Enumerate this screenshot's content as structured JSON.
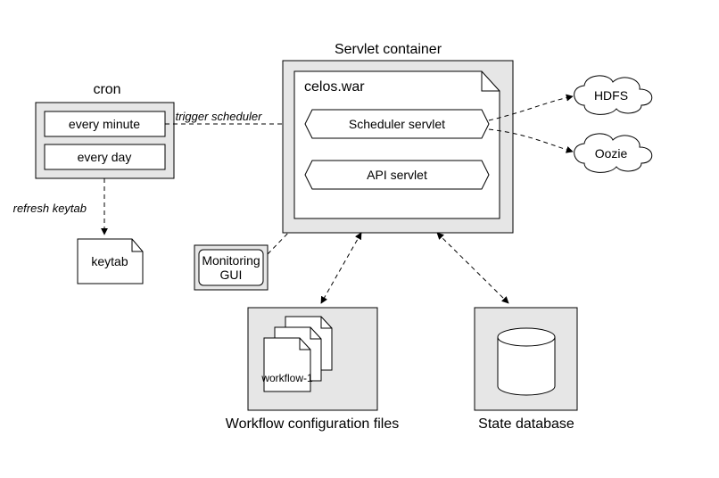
{
  "cron": {
    "title": "cron",
    "items": [
      "every minute",
      "every day"
    ]
  },
  "edges": {
    "trigger": "trigger scheduler",
    "refresh": "refresh keytab"
  },
  "keytab": {
    "label": "keytab"
  },
  "monitoring": {
    "line1": "Monitoring",
    "line2": "GUI"
  },
  "servlet": {
    "title": "Servlet container",
    "war": "celos.war",
    "scheduler": "Scheduler servlet",
    "api": "API servlet"
  },
  "clouds": {
    "hdfs": "HDFS",
    "oozie": "Oozie"
  },
  "workflows": {
    "file": "workflow-1",
    "caption": "Workflow configuration files"
  },
  "statedb": {
    "caption": "State database"
  }
}
